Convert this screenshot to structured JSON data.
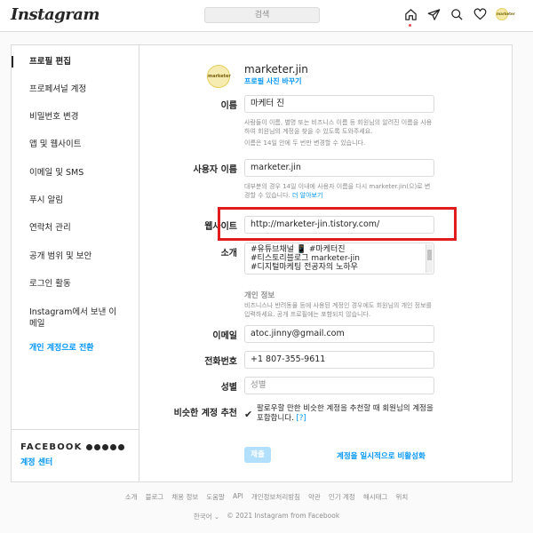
{
  "header": {
    "logo": "Instagram",
    "search_placeholder": "검색",
    "nav_icons": [
      "home-icon",
      "send-icon",
      "explore-icon",
      "heart-icon",
      "profile-avatar"
    ],
    "avatar_text": "marketer"
  },
  "sidebar": {
    "items": [
      {
        "label": "프로필 편집",
        "active": true
      },
      {
        "label": "프로페셔널 계정"
      },
      {
        "label": "비밀번호 변경"
      },
      {
        "label": "앱 및 웹사이트"
      },
      {
        "label": "이메일 및 SMS"
      },
      {
        "label": "푸시 알림"
      },
      {
        "label": "연락처 관리"
      },
      {
        "label": "공개 범위 및 보안"
      },
      {
        "label": "로그인 활동"
      },
      {
        "label": "Instagram에서 보낸 이메일"
      }
    ],
    "switch_link": "개인 계정으로 전환",
    "facebook_title": "FACEBOOK",
    "accounts_center": "계정 센터"
  },
  "profile": {
    "avatar_text": "marketer",
    "username": "marketer.jin",
    "change_photo": "프로필 사진 바꾸기"
  },
  "form": {
    "name_label": "이름",
    "name_value": "마케터 진",
    "name_help1": "사람들이 이름, 별명 또는 비즈니스 이름 등 회원님의 알려진 이름을 사용하여 회원님의 계정을 찾을 수 있도록 도와주세요.",
    "name_help2": "이름은 14일 안에 두 번만 변경할 수 있습니다.",
    "username_label": "사용자 이름",
    "username_value": "marketer.jin",
    "username_help": "대부분의 경우 14일 이내에 사용자 이름을 다시 marketer.jin(으)로 변경할 수 있습니다.",
    "username_help_link": "더 알아보기",
    "website_label": "웹사이트",
    "website_value": "http://marketer-jin.tistory.com/",
    "bio_label": "소개",
    "bio_lines": [
      "#유튜브채널 📱 #마케터진",
      "#티스토리블로그 marketer-jin",
      "#디지털마케팅 전공자의 노하우"
    ],
    "personal_info_title": "개인 정보",
    "personal_info_help": "비즈니스나 반려동물 등에 사용된 계정인 경우에도 회원님의 개인 정보를 입력하세요. 공개 프로필에는 포함되지 않습니다.",
    "email_label": "이메일",
    "email_value": "atoc.jinny@gmail.com",
    "phone_label": "전화번호",
    "phone_value": "+1 807-355-9611",
    "gender_label": "성별",
    "gender_placeholder": "성별",
    "suggest_label": "비슷한 계정 추천",
    "suggest_text": "팔로우할 만한 비슷한 계정을 추천할 때 회원님의 계정을 포함합니다.",
    "suggest_link": "[?]",
    "suggest_checked": true,
    "submit_label": "제출",
    "disable_link": "계정을 일시적으로 비활성화"
  },
  "footer": {
    "links": [
      "소개",
      "블로그",
      "채용 정보",
      "도움말",
      "API",
      "개인정보처리방침",
      "약관",
      "인기 계정",
      "해시태그",
      "위치"
    ],
    "language": "한국어 ⌄",
    "copyright": "© 2021 Instagram from Facebook"
  },
  "colors": {
    "accent": "#0095f6",
    "highlight": "#e01c1c",
    "border": "#dbdbdb"
  }
}
